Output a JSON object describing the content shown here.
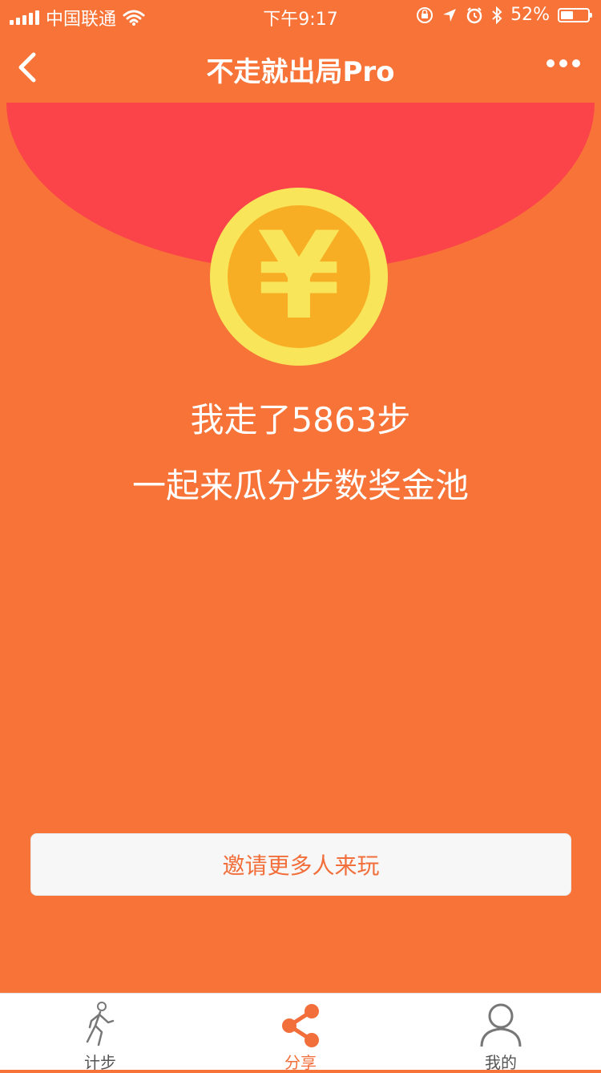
{
  "status_bar": {
    "carrier": "中国联通",
    "time": "下午9:17",
    "battery": "52%",
    "battery_level": 0.52
  },
  "nav": {
    "title": "不走就出局Pro"
  },
  "coin": {
    "symbol": "¥"
  },
  "main": {
    "steps_text": "我走了5863步",
    "invite_text": "一起来瓜分步数奖金池",
    "invite_button": "邀请更多人来玩"
  },
  "tabs": [
    {
      "label": "计步",
      "icon": "walking-person-icon",
      "active": false
    },
    {
      "label": "分享",
      "icon": "share-icon",
      "active": true
    },
    {
      "label": "我的",
      "icon": "person-icon",
      "active": false
    }
  ],
  "colors": {
    "background": "#F77337",
    "flap": "#FB434A",
    "coin_outer": "#F8E55A",
    "coin_inner": "#F7AE25",
    "accent": "#F26E3A"
  }
}
